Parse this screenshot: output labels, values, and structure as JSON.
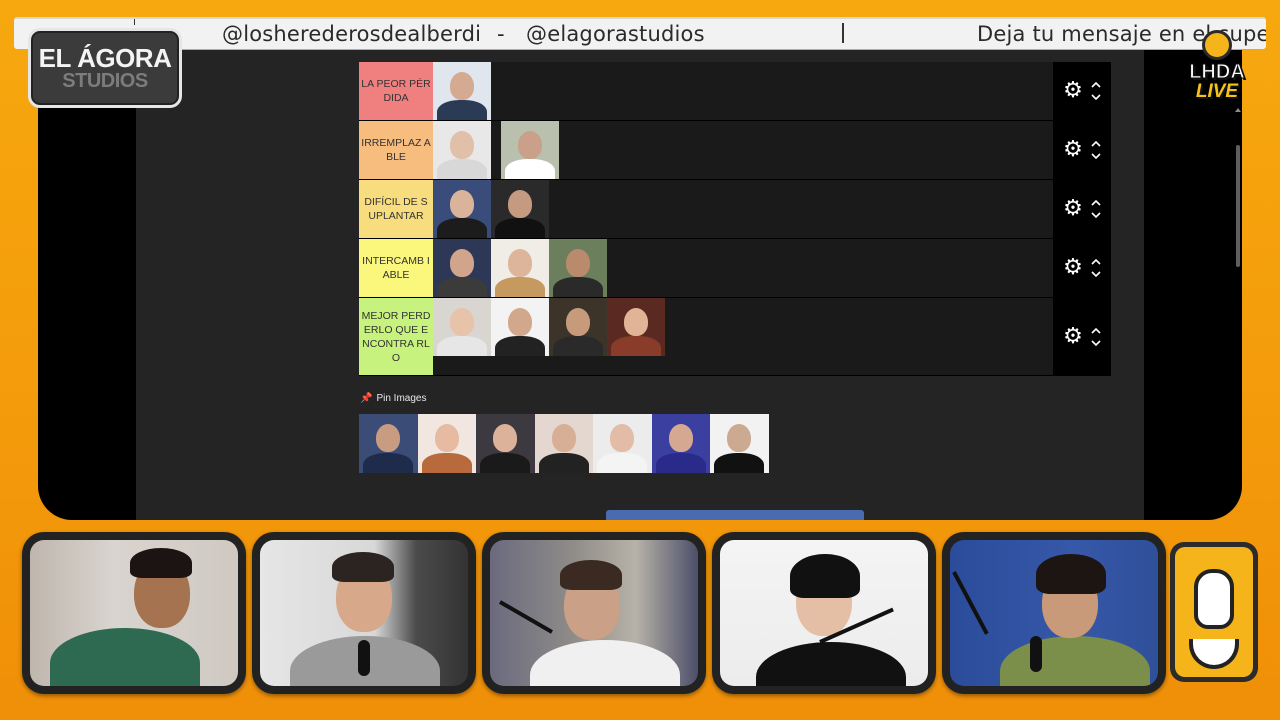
{
  "ticker": {
    "handle_1": "@losherederosdealberdi",
    "dash": "-",
    "handle_2": "@elagorastudios",
    "message": "Deja tu mensaje en el super"
  },
  "logo_left": {
    "line1": "EL ÁGORA",
    "line2": "STUDIOS"
  },
  "logo_right": {
    "line1": "LHDA",
    "line2": "LIVE"
  },
  "tiers": [
    {
      "label": "LA PEOR PÉRDIDA",
      "color": "#f08080",
      "items": 1
    },
    {
      "label": "IRREMPLAZ ABLE",
      "color": "#f7bd7e",
      "items": 2
    },
    {
      "label": "DIFÍCIL DE SUPLANTAR",
      "color": "#f8dd7e",
      "items": 2
    },
    {
      "label": "INTERCAMB IABLE",
      "color": "#fbf67c",
      "items": 3
    },
    {
      "label": "MEJOR PERDERLO QUE ENCONTRA RLO",
      "color": "#c8f27e",
      "items": 4
    }
  ],
  "pin_images": {
    "label": "Pin Images",
    "count": 7
  },
  "colors": {
    "frame": "#f5a20f",
    "accent_blue": "#4a6bb0"
  },
  "icons": {
    "settings": "gear-icon",
    "move_up": "chevron-up-icon",
    "move_down": "chevron-down-icon",
    "pin": "pushpin-icon"
  }
}
